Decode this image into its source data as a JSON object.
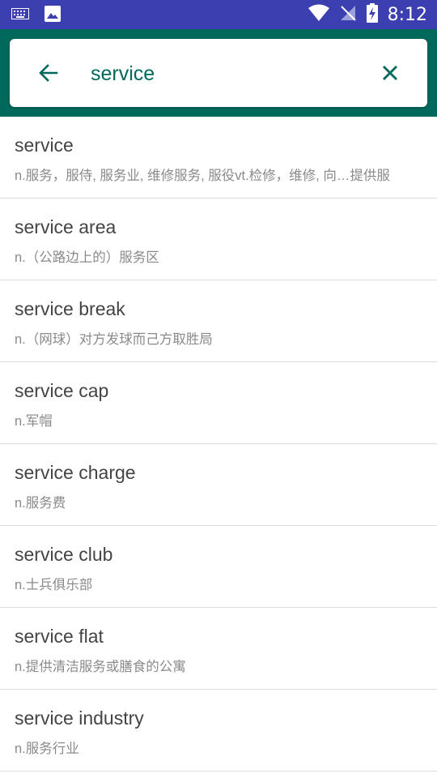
{
  "status_bar": {
    "time": "8:12",
    "left_icons": [
      "keyboard-icon",
      "image-icon"
    ],
    "right_icons": [
      "wifi-icon",
      "no-signal-icon",
      "battery-charging-icon"
    ]
  },
  "search": {
    "query": "service",
    "back_icon": "arrow-left-icon",
    "clear_icon": "close-icon"
  },
  "colors": {
    "status_bar": "#3b3fb0",
    "app_bar": "#00695c",
    "accent": "#00695c",
    "word_text": "#444444",
    "definition_text": "#8a8a8a"
  },
  "results": [
    {
      "word": "service",
      "definition": "n.服务，服侍, 服务业, 维修服务, 服役vt.检修，维修, 向…提供服"
    },
    {
      "word": "service area",
      "definition": "n.（公路边上的）服务区"
    },
    {
      "word": "service break",
      "definition": "n.（网球）对方发球而己方取胜局"
    },
    {
      "word": "service cap",
      "definition": "n.军帽"
    },
    {
      "word": "service charge",
      "definition": "n.服务费"
    },
    {
      "word": "service club",
      "definition": "n.士兵俱乐部"
    },
    {
      "word": "service flat",
      "definition": "n.提供清洁服务或膳食的公寓"
    },
    {
      "word": "service industry",
      "definition": "n.服务行业"
    }
  ]
}
